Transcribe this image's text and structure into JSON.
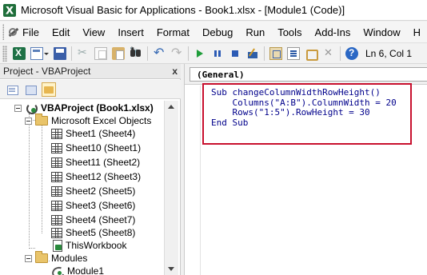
{
  "window": {
    "title": "Microsoft Visual Basic for Applications - Book1.xlsx - [Module1 (Code)]",
    "app_icon": "excel-icon"
  },
  "menu": {
    "items": [
      {
        "label": "File"
      },
      {
        "label": "Edit"
      },
      {
        "label": "View"
      },
      {
        "label": "Insert"
      },
      {
        "label": "Format"
      },
      {
        "label": "Debug"
      },
      {
        "label": "Run"
      },
      {
        "label": "Tools"
      },
      {
        "label": "Add-Ins"
      },
      {
        "label": "Window"
      },
      {
        "label": "H"
      }
    ]
  },
  "toolbar": {
    "icons": [
      "view-excel-icon",
      "insert-userform-icon",
      "save-icon",
      "cut-icon",
      "copy-icon",
      "paste-icon",
      "find-icon",
      "undo-icon",
      "redo-icon",
      "run-icon",
      "break-icon",
      "reset-icon",
      "design-mode-icon",
      "project-explorer-icon",
      "properties-icon",
      "object-browser-icon",
      "toolbox-icon",
      "help-icon"
    ],
    "position_text": "Ln 6, Col 1"
  },
  "project_panel": {
    "title": "Project - VBAProject",
    "close_label": "x",
    "tree": {
      "root": "VBAProject (Book1.xlsx)",
      "objects_folder": "Microsoft Excel Objects",
      "sheets": [
        "Sheet1 (Sheet4)",
        "Sheet10 (Sheet1)",
        "Sheet11 (Sheet2)",
        "Sheet12 (Sheet3)",
        "Sheet2 (Sheet5)",
        "Sheet3 (Sheet6)",
        "Sheet4 (Sheet7)",
        "Sheet5 (Sheet8)"
      ],
      "workbook": "ThisWorkbook",
      "modules_folder": "Modules",
      "module": "Module1"
    }
  },
  "code_window": {
    "object_combo": "(General)",
    "lines": [
      "Sub changeColumnWidthRowHeight()",
      "    Columns(\"A:B\").ColumnWidth = 20",
      "    Rows(\"1:5\").RowHeight = 30",
      "End Sub"
    ]
  },
  "colors": {
    "highlight_box": "#c8102e",
    "code_text": "#00008b"
  }
}
